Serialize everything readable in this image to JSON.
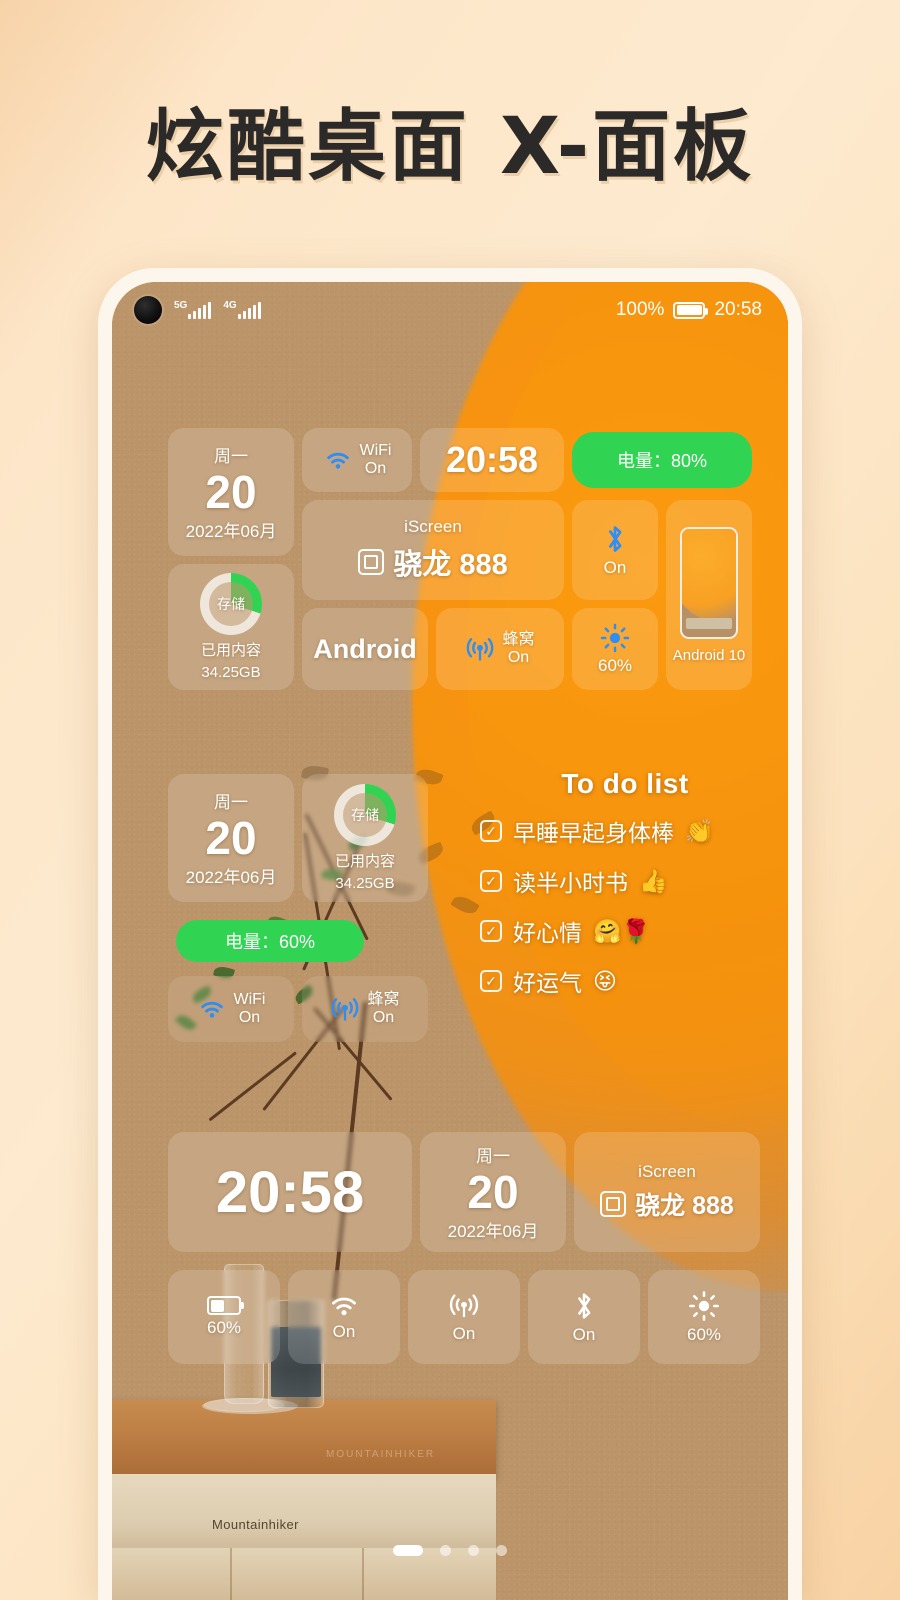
{
  "headline": "炫酷桌面 X-面板",
  "status_bar": {
    "network_5g": "5G",
    "network_4g": "4G",
    "battery_percent": "100%",
    "time": "20:58"
  },
  "wallpaper": {
    "brand_label": "Mountainhiker",
    "logo_text": "MOUNTAINHIKER"
  },
  "panel_top": {
    "date_widget": {
      "weekday": "周一",
      "day": "20",
      "year_month": "2022年06月"
    },
    "wifi_widget": {
      "label": "WiFi",
      "state": "On"
    },
    "clock_widget": {
      "time": "20:58"
    },
    "battery_widget": {
      "text": "电量：80%",
      "color": "#31d452"
    },
    "storage_widget": {
      "ring_label": "存储",
      "caption": "已用内容",
      "value": "34.25GB",
      "used_ratio": 0.3
    },
    "chip_widget": {
      "title": "iScreen",
      "name": "骁龙 888"
    },
    "os_widget": {
      "name": "Android"
    },
    "cellular_widget": {
      "label": "蜂窝",
      "state": "On"
    },
    "bluetooth_widget": {
      "state": "On"
    },
    "brightness_widget": {
      "value": "60%"
    },
    "preview_widget": {
      "label": "Android 10"
    }
  },
  "panel_middle": {
    "date_widget": {
      "weekday": "周一",
      "day": "20",
      "year_month": "2022年06月"
    },
    "storage_widget": {
      "ring_label": "存储",
      "caption": "已用内容",
      "value": "34.25GB",
      "used_ratio": 0.3
    },
    "battery_widget": {
      "text": "电量：60%",
      "color": "#31d452"
    },
    "wifi_widget": {
      "label": "WiFi",
      "state": "On"
    },
    "cellular_widget": {
      "label": "蜂窝",
      "state": "On"
    },
    "todo": {
      "title": "To do list",
      "items": [
        {
          "check": "✓",
          "text": "早睡早起身体棒",
          "emoji": "👏"
        },
        {
          "check": "✓",
          "text": "读半小时书",
          "emoji": "👍"
        },
        {
          "check": "✓",
          "text": "好心情",
          "emoji": "🤗🌹"
        },
        {
          "check": "✓",
          "text": "好运气",
          "emoji": "😝"
        }
      ]
    }
  },
  "panel_bottom": {
    "clock_widget": {
      "time": "20:58"
    },
    "date_widget": {
      "weekday": "周一",
      "day": "20",
      "year_month": "2022年06月"
    },
    "chip_widget": {
      "title": "iScreen",
      "name": "骁龙 888"
    },
    "toggles": [
      {
        "icon": "battery-icon",
        "label": "60%"
      },
      {
        "icon": "wifi-icon",
        "label": "On"
      },
      {
        "icon": "cellular-icon",
        "label": "On"
      },
      {
        "icon": "bluetooth-icon",
        "label": "On"
      },
      {
        "icon": "brightness-icon",
        "label": "60%"
      }
    ]
  },
  "page_indicator": {
    "count": 4,
    "active": 1
  }
}
